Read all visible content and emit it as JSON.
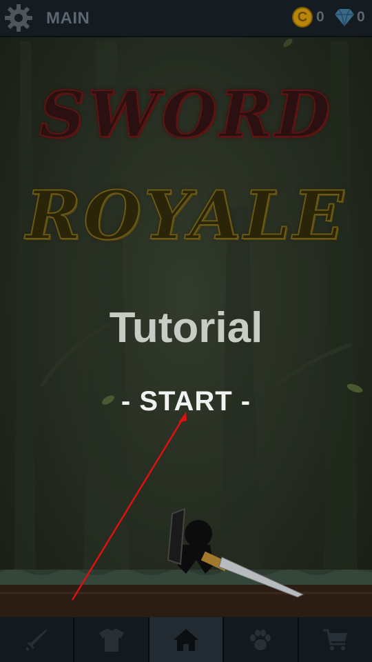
{
  "topbar": {
    "title": "MAIN",
    "coin_symbol": "C",
    "coins": "0",
    "gems": "0"
  },
  "logo": {
    "line1": "SWORD",
    "line2": "ROYALE"
  },
  "menu": {
    "mode": "Tutorial",
    "start_label": "- START -"
  },
  "nav": {
    "items": [
      {
        "icon": "sword-icon"
      },
      {
        "icon": "shirt-icon"
      },
      {
        "icon": "home-icon",
        "active": true
      },
      {
        "icon": "paw-icon"
      },
      {
        "icon": "cart-icon"
      }
    ]
  },
  "colors": {
    "topbar_bg": "#141b21",
    "forest_bg": "#283024",
    "logo_red": "#5c1414",
    "logo_gold": "#6a5a16",
    "coin": "#b8860b",
    "gem": "#3a6a8a",
    "arrow": "#e01010"
  }
}
